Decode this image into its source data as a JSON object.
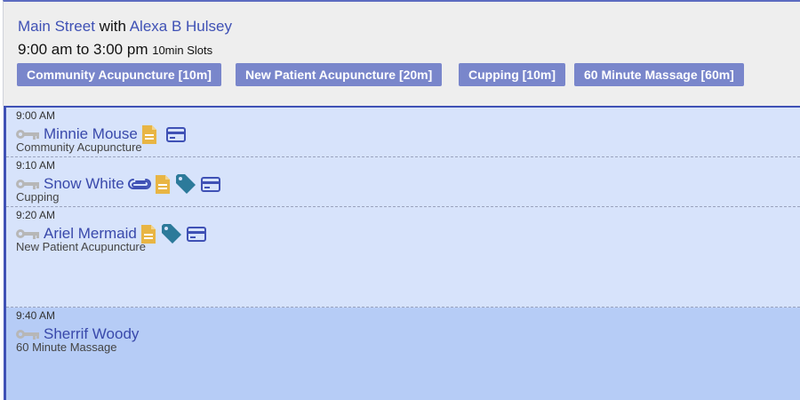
{
  "header": {
    "location": "Main Street",
    "with_word": "with",
    "provider": "Alexa B Hulsey",
    "time_range": "9:00 am to 3:00 pm",
    "slot_info": "10min Slots"
  },
  "services": [
    {
      "label": "Community Acupuncture [10m]"
    },
    {
      "label": "New Patient Acupuncture [20m]"
    },
    {
      "label": "Cupping [10m]"
    },
    {
      "label": "60 Minute Massage [60m]"
    }
  ],
  "appointments": [
    {
      "time": "9:00 AM",
      "patient": "Minnie Mouse",
      "service": "Community Acupuncture",
      "icons": [
        "key-icon",
        "document-icon",
        "credit-card-icon"
      ]
    },
    {
      "time": "9:10 AM",
      "patient": "Snow White",
      "service": "Cupping",
      "icons": [
        "key-icon",
        "paperclip-icon",
        "document-icon",
        "tag-icon",
        "credit-card-icon"
      ]
    },
    {
      "time": "9:20 AM",
      "patient": "Ariel Mermaid",
      "service": "New Patient Acupuncture",
      "icons": [
        "key-icon",
        "document-icon",
        "tag-icon",
        "credit-card-icon"
      ]
    },
    {
      "time": "9:40 AM",
      "patient": "Sherrif Woody",
      "service": "60 Minute Massage",
      "icons": [
        "key-icon"
      ]
    }
  ],
  "colors": {
    "accent": "#3f51b5",
    "button_bg": "#7986cb",
    "slot_light": "#d7e3fb",
    "slot_mid": "#b6ccf6",
    "document_icon": "#e8b544",
    "tag_icon": "#2c7a9a",
    "card_icon": "#3f51b5",
    "key_icon": "#b7b7b7"
  }
}
